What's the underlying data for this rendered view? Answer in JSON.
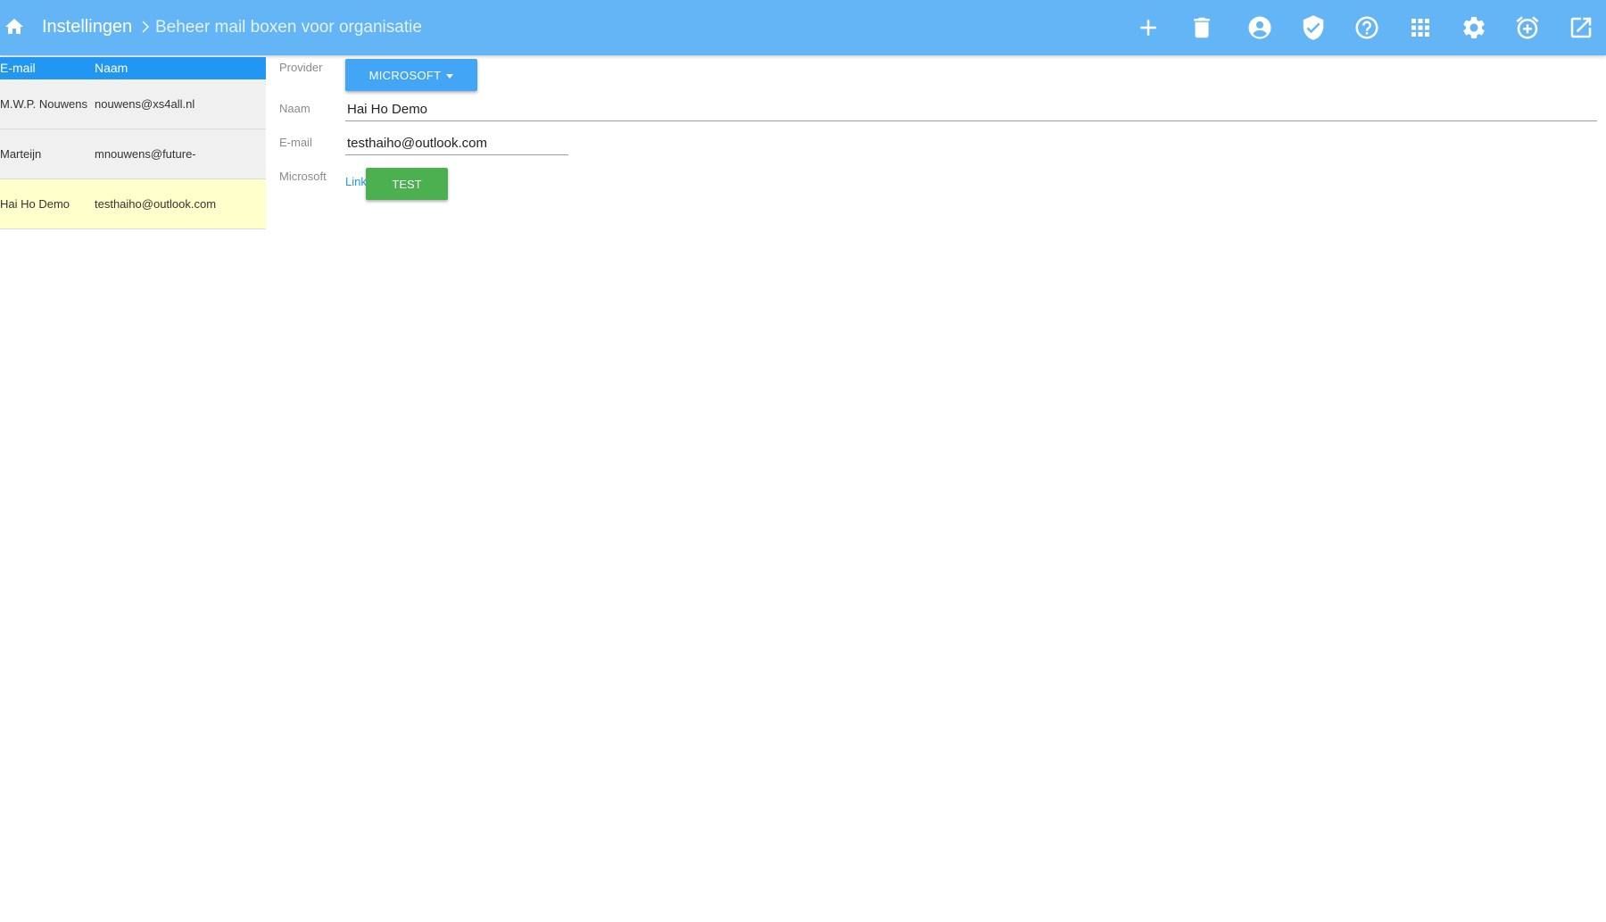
{
  "header": {
    "breadcrumb_root": "Instellingen",
    "breadcrumb_current": "Beheer mail boxen voor organisatie",
    "background_color": "#64b5f6",
    "toolbar_icons": [
      "home-icon",
      "add-icon",
      "trash-icon",
      "account-circle-icon",
      "shield-check-icon",
      "help-circle-icon",
      "apps-grid-icon",
      "gear-icon",
      "alarm-add-icon",
      "open-in-new-icon"
    ]
  },
  "mailbox_list": {
    "columns": [
      "E-mail",
      "Naam"
    ],
    "header_color": "#2196f3",
    "selected_row_color": "#ffffcc",
    "rows": [
      {
        "email": "M.W.P. Nouwens",
        "naam": "nouwens@xs4all.nl"
      },
      {
        "email": "Marteijn",
        "naam": "mnouwens@future-"
      },
      {
        "email": "Hai Ho Demo",
        "naam": "testhaiho@outlook.com"
      }
    ]
  },
  "form": {
    "provider_label": "Provider",
    "provider_value": "MICROSOFT",
    "naam_label": "Naam",
    "naam_value": "Hai Ho Demo",
    "email_label": "E-mail",
    "email_value": "testhaiho@outlook.com",
    "microsoft_label": "Microsoft",
    "link_text": "Link",
    "test_button": "TEST",
    "test_button_color": "#4caf50"
  }
}
